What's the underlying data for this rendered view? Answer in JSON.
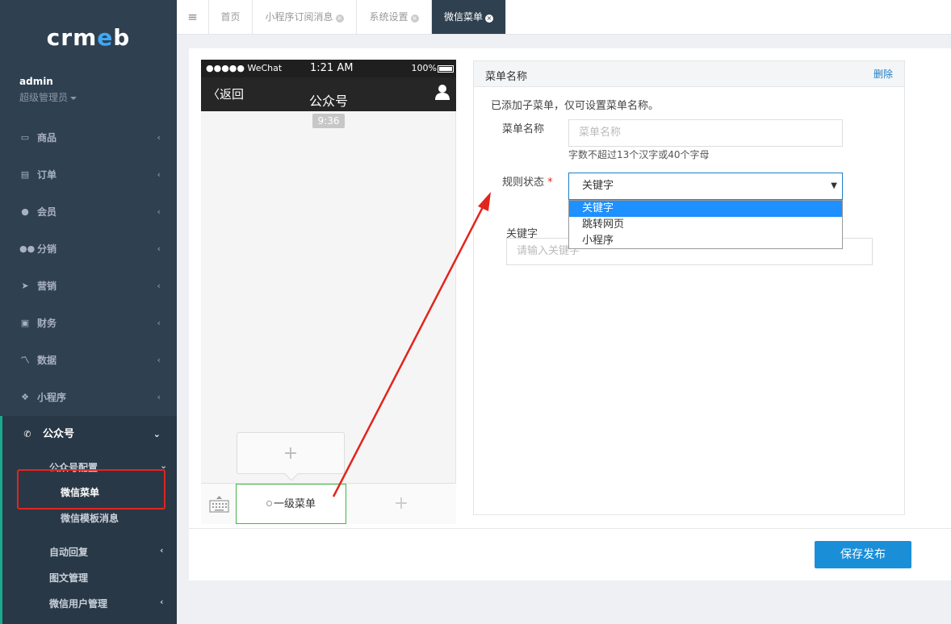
{
  "sidebar": {
    "logo": {
      "pre": "crm",
      "accent": "e",
      "post": "b"
    },
    "user": {
      "name": "admin",
      "role": "超级管理员"
    },
    "items": [
      {
        "label": "商品",
        "icon": "laptop-icon",
        "glyph": "▭"
      },
      {
        "label": "订单",
        "icon": "clipboard-icon",
        "glyph": "▤"
      },
      {
        "label": "会员",
        "icon": "user-icon",
        "glyph": "●"
      },
      {
        "label": "分销",
        "icon": "users-icon",
        "glyph": "●●"
      },
      {
        "label": "营销",
        "icon": "paper-plane-icon",
        "glyph": "➤"
      },
      {
        "label": "财务",
        "icon": "money-icon",
        "glyph": "▣"
      },
      {
        "label": "数据",
        "icon": "line-chart-icon",
        "glyph": "📈"
      },
      {
        "label": "小程序",
        "icon": "cubes-icon",
        "glyph": "❖"
      },
      {
        "label": "公众号",
        "icon": "wechat-icon",
        "glyph": "💬"
      }
    ],
    "sub": {
      "config": "公众号配置",
      "wechat_menu": "微信菜单",
      "template_msg": "微信模板消息",
      "auto_reply": "自动回复",
      "article_mgmt": "图文管理",
      "user_mgmt": "微信用户管理"
    }
  },
  "tabs": [
    {
      "label": "首页",
      "closable": false
    },
    {
      "label": "小程序订阅消息",
      "closable": true
    },
    {
      "label": "系统设置",
      "closable": true
    },
    {
      "label": "微信菜单",
      "closable": true,
      "active": true
    }
  ],
  "phone": {
    "status_left": "●●●●● WeChat",
    "time": "1:21 AM",
    "battery": "100%",
    "back": "返回",
    "title": "公众号",
    "msg_time": "9:36",
    "menu_item": "一级菜单"
  },
  "form": {
    "header": "菜单名称",
    "delete": "删除",
    "notice": "已添加子菜单，仅可设置菜单名称。",
    "name_label": "菜单名称",
    "name_placeholder": "菜单名称",
    "name_hint": "字数不超过13个汉字或40个字母",
    "rule_label": "规则状态",
    "rule_required": "*",
    "rule_value": "关键字",
    "options": [
      "关键字",
      "跳转网页",
      "小程序"
    ],
    "keyword_label": "关键字",
    "keyword_placeholder": "请输入关键字"
  },
  "save_button": "保存发布",
  "colors": {
    "accent": "#1a8fd8",
    "sidebar": "#2f4050",
    "highlight": "#e3241e",
    "menu_border": "#44b549"
  }
}
